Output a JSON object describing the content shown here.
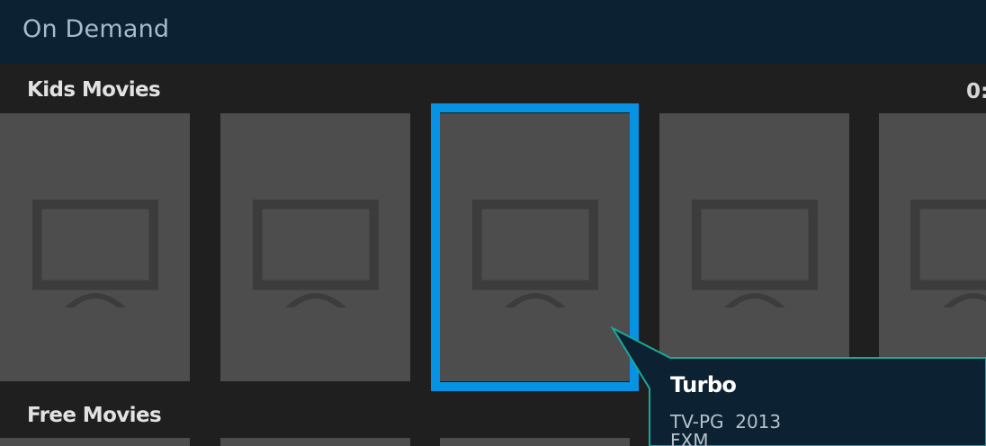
{
  "header": {
    "title": "On Demand"
  },
  "sections": [
    {
      "title": "Kids Movies",
      "counter": "0:"
    },
    {
      "title": "Free Movies"
    }
  ],
  "tile_icon": "tv-placeholder-icon",
  "selected": {
    "title": "Turbo",
    "rating": "TV-PG",
    "year": "2013",
    "provider": "FXM"
  },
  "colors": {
    "header_bg": "#0c2232",
    "page_bg": "#1f1f1f",
    "tile_bg": "#4d4d4d",
    "focus": "#0693e3",
    "callout_border": "#1aa89b",
    "callout_bg": "#0c2232"
  }
}
